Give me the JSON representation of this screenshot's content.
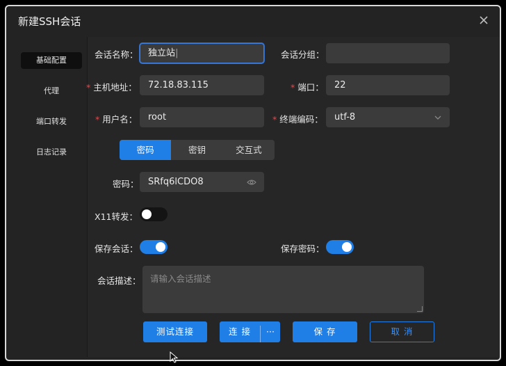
{
  "dialog": {
    "title": "新建SSH会话",
    "close_label": "X"
  },
  "sidebar": {
    "items": [
      {
        "label": "基础配置",
        "active": true
      },
      {
        "label": "代理"
      },
      {
        "label": "端口转发"
      },
      {
        "label": "日志记录"
      }
    ]
  },
  "form": {
    "session_name": {
      "label": "会话名称：",
      "value": "独立站"
    },
    "session_group": {
      "label": "会话分组：",
      "value": ""
    },
    "host": {
      "label": "主机地址：",
      "value": "72.18.83.115",
      "required": true
    },
    "port": {
      "label": "端口：",
      "value": "22",
      "required": true
    },
    "username": {
      "label": "用户名：",
      "value": "root",
      "required": true
    },
    "encoding": {
      "label": "终端编码：",
      "value": "utf-8",
      "required": true
    },
    "auth_tabs": [
      "密码",
      "密钥",
      "交互式"
    ],
    "auth_selected": "密码",
    "password": {
      "label": "密码：",
      "value": "SRfq6lCDO8"
    },
    "x11": {
      "label": "X11转发：",
      "enabled": false
    },
    "save_session": {
      "label": "保存会话：",
      "enabled": true
    },
    "save_password": {
      "label": "保存密码：",
      "enabled": true
    },
    "description": {
      "label": "会话描述：",
      "placeholder": "请输入会话描述"
    }
  },
  "buttons": {
    "test": "测试连接",
    "connect": "连 接",
    "more": "···",
    "save": "保 存",
    "cancel": "取 消"
  },
  "icons": {
    "eye": "eye-icon",
    "chevron": "chevron-down-icon",
    "cursor": "mouse-pointer-icon"
  },
  "colors": {
    "accent": "#1f7fe6",
    "required": "#e5484d",
    "background": "#232323"
  }
}
